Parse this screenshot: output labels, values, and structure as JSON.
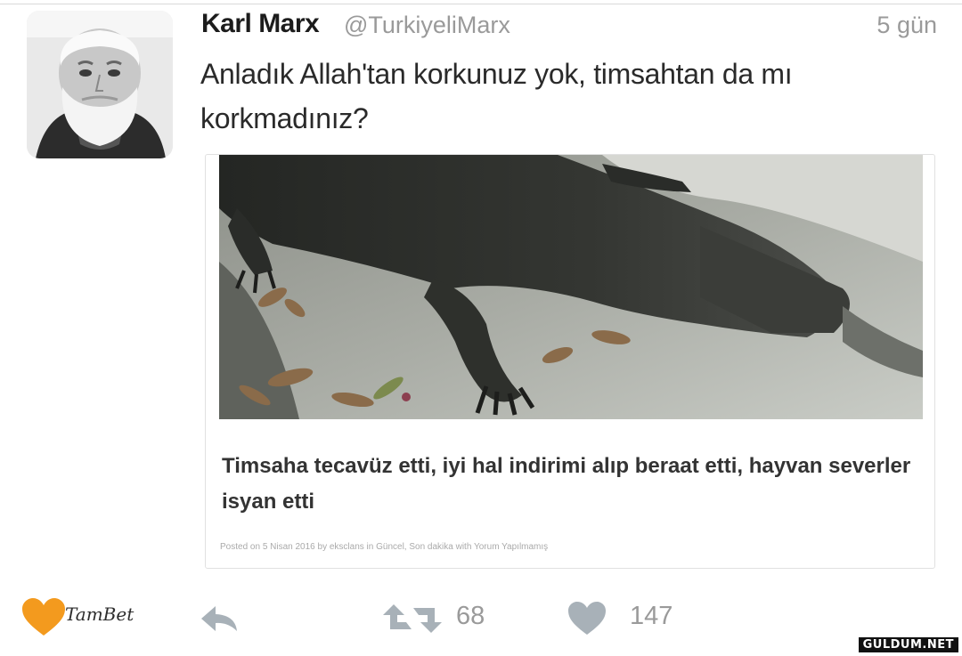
{
  "tweet": {
    "author_name": "Karl Marx",
    "author_handle": "@TurkiyeliMarx",
    "time": "5 gün",
    "text": "Anladık Allah'tan korkunuz yok, timsahtan da mı korkmadınız?"
  },
  "card": {
    "headline": "Timsaha tecavüz etti, iyi hal indirimi alıp beraat etti, hayvan severler isyan etti",
    "meta": "Posted on 5 Nisan 2016 by eksclans in Güncel, Son dakika with Yorum Yapılmamış"
  },
  "actions": {
    "retweet_count": "68",
    "like_count": "147"
  },
  "brand": {
    "text": "TamBet"
  },
  "watermark": {
    "text": "GULDUM.NET"
  },
  "colors": {
    "heart": "#f39a1e",
    "icons": "#a8b1b8"
  }
}
